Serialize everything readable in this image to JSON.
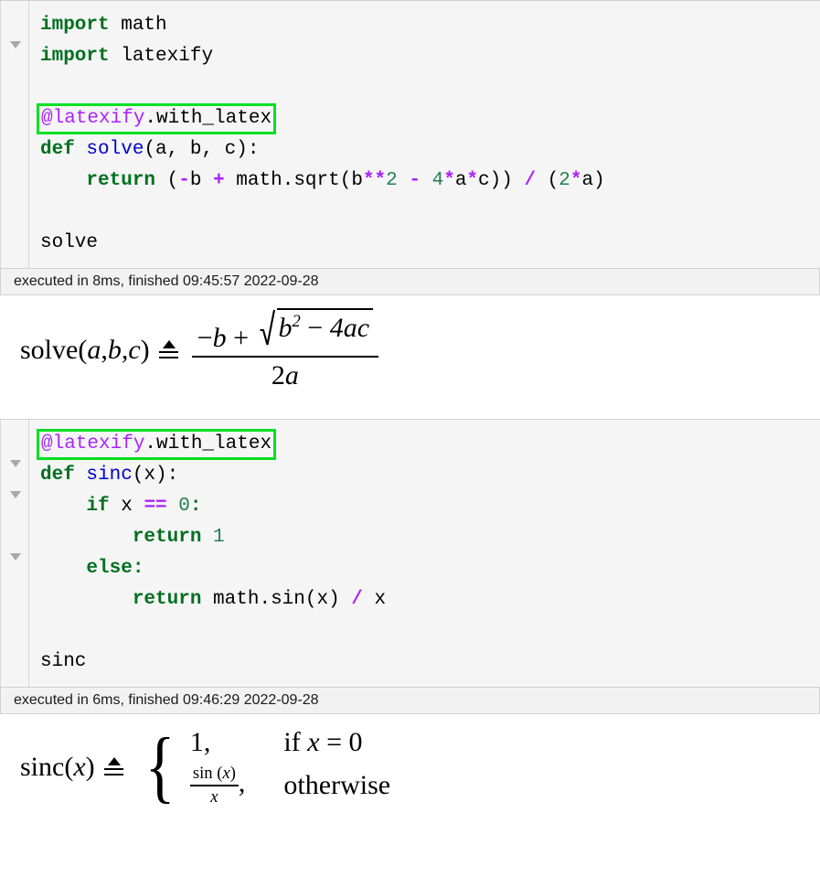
{
  "notebook": {
    "cells": [
      {
        "id": "cell-1",
        "status": "executed in 8ms, finished 09:45:57 2022-09-28",
        "decorator": {
          "at_name": "@latexify",
          "attr": ".with_latex"
        },
        "code_lines": [
          "import math",
          "import latexify",
          "",
          "@latexify.with_latex",
          "def solve(a, b, c):",
          "    return (-b + math.sqrt(b**2 - 4*a*c)) / (2*a)",
          "",
          "solve"
        ],
        "tokens": {
          "import_kw": "import",
          "module_math": " math",
          "module_latexify": " latexify",
          "def_kw": "def",
          "fn_name": "solve",
          "params": "(a, b, c):",
          "return_kw": "return",
          "expr_a": " (",
          "op_minus": "-",
          "var_b": "b ",
          "op_plus": "+",
          "expr_b": " math.sqrt(b",
          "op_pow": "**",
          "num_2": "2",
          "expr_c": " ",
          "op_minus2": "-",
          "expr_d": " ",
          "num_4": "4",
          "op_star1": "*",
          "var_a": "a",
          "op_star2": "*",
          "var_c": "c)) ",
          "op_div": "/",
          "expr_e": " (",
          "num_2b": "2",
          "op_star3": "*",
          "var_a2": "a)",
          "result_repr": "solve"
        },
        "fold_triangles": [
          1
        ],
        "output": {
          "type": "latex-equation",
          "lhs": "solve(a, b, c)",
          "relation": "triangle-equals",
          "rhs_numerator": "−b + √(b² − 4ac)",
          "rhs_denominator": "2a",
          "parts": {
            "name": "solve",
            "open_paren": "(",
            "arg_a": "a",
            "comma1": ", ",
            "arg_b": "b",
            "comma2": ", ",
            "arg_c": "c",
            "close_paren": ")",
            "minus": "−",
            "b": "b",
            "plus": "+",
            "radicand_b": "b",
            "exp_2": "2",
            "minus2": "−",
            "four_ac": "4ac",
            "denom_2": "2",
            "denom_a": "a"
          }
        }
      },
      {
        "id": "cell-2",
        "status": "executed in 6ms, finished 09:46:29 2022-09-28",
        "decorator": {
          "at_name": "@latexify",
          "attr": ".with_latex"
        },
        "code_lines": [
          "@latexify.with_latex",
          "def sinc(x):",
          "    if x == 0:",
          "        return 1",
          "    else:",
          "        return math.sin(x) / x",
          "",
          "sinc"
        ],
        "tokens": {
          "def_kw": "def",
          "fn_name": "sinc",
          "params": "(x):",
          "if_kw": "if",
          "var_x": " x ",
          "op_eq": "==",
          "space1": " ",
          "num_0": "0",
          "colon1": ":",
          "return_kw": "return",
          "num_1": " 1",
          "else_kw": "else",
          "colon2": ":",
          "return_kw2": "return",
          "expr_sin": " math.sin(x) ",
          "op_div": "/",
          "var_x2": " x",
          "result_repr": "sinc"
        },
        "fold_triangles": [
          1,
          2,
          4
        ],
        "output": {
          "type": "latex-equation-piecewise",
          "lhs": "sinc(x)",
          "relation": "triangle-equals",
          "cases": [
            {
              "value": "1,",
              "condition": "if x = 0"
            },
            {
              "value": "sin (x) / x ,",
              "condition": "otherwise"
            }
          ],
          "parts": {
            "name": "sinc",
            "open_paren": "(",
            "arg_x": "x",
            "close_paren": ")",
            "brace": "{",
            "case1_value": "1,",
            "case1_if": "if ",
            "case1_var": "x",
            "case1_eq": " = ",
            "case1_zero": "0",
            "case2_sin": "sin (",
            "case2_var": "x",
            "case2_close": ")",
            "case2_denom": "x",
            "case2_comma": ",",
            "case2_cond": "otherwise"
          }
        }
      }
    ]
  },
  "colors": {
    "keyword": "#007020",
    "function": "#0000cf",
    "number": "#208050",
    "operator": "#aa22ff",
    "decorator": "#aa22ff",
    "highlight_box": "#00e020",
    "cell_background": "#f5f5f5",
    "status_background": "#f2f2f2"
  }
}
